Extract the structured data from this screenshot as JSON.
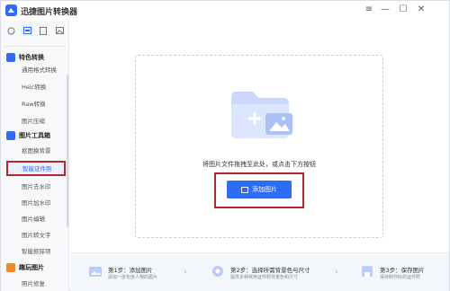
{
  "app": {
    "title": "迅捷图片转换器"
  },
  "window": {
    "minimize": "—",
    "maximize": "☐",
    "close": "✕"
  },
  "sidebar": {
    "groups": [
      {
        "label": "特色转换",
        "color": "#2e6cf6"
      },
      {
        "label": "图片工具箱",
        "color": "#2e6cf6"
      },
      {
        "label": "趣玩图片",
        "color": "#f08a24"
      }
    ],
    "items": [
      "通用格式转换",
      "Heic转换",
      "Raw转换",
      "图片压缩",
      "抠图换背景",
      "智能证件照",
      "图片去水印",
      "图片加水印",
      "图片编辑",
      "图片转文字",
      "智能抠除项",
      "照片修复"
    ]
  },
  "main": {
    "hint": "将图片文件拖拽至此处，或点击下方按钮",
    "add_button": "添加图片"
  },
  "steps": [
    {
      "title": "第1步：添加图片",
      "desc": "添加一张包含人物的图片"
    },
    {
      "title": "第2步：选择所需背景色与尺寸",
      "desc": "提供多种常用证件照背景色和尺寸"
    },
    {
      "title": "第3步：保存图片",
      "desc": "保存制作好的证件照"
    }
  ],
  "colors": {
    "accent": "#2e6cf6",
    "highlight": "#b3282d"
  }
}
